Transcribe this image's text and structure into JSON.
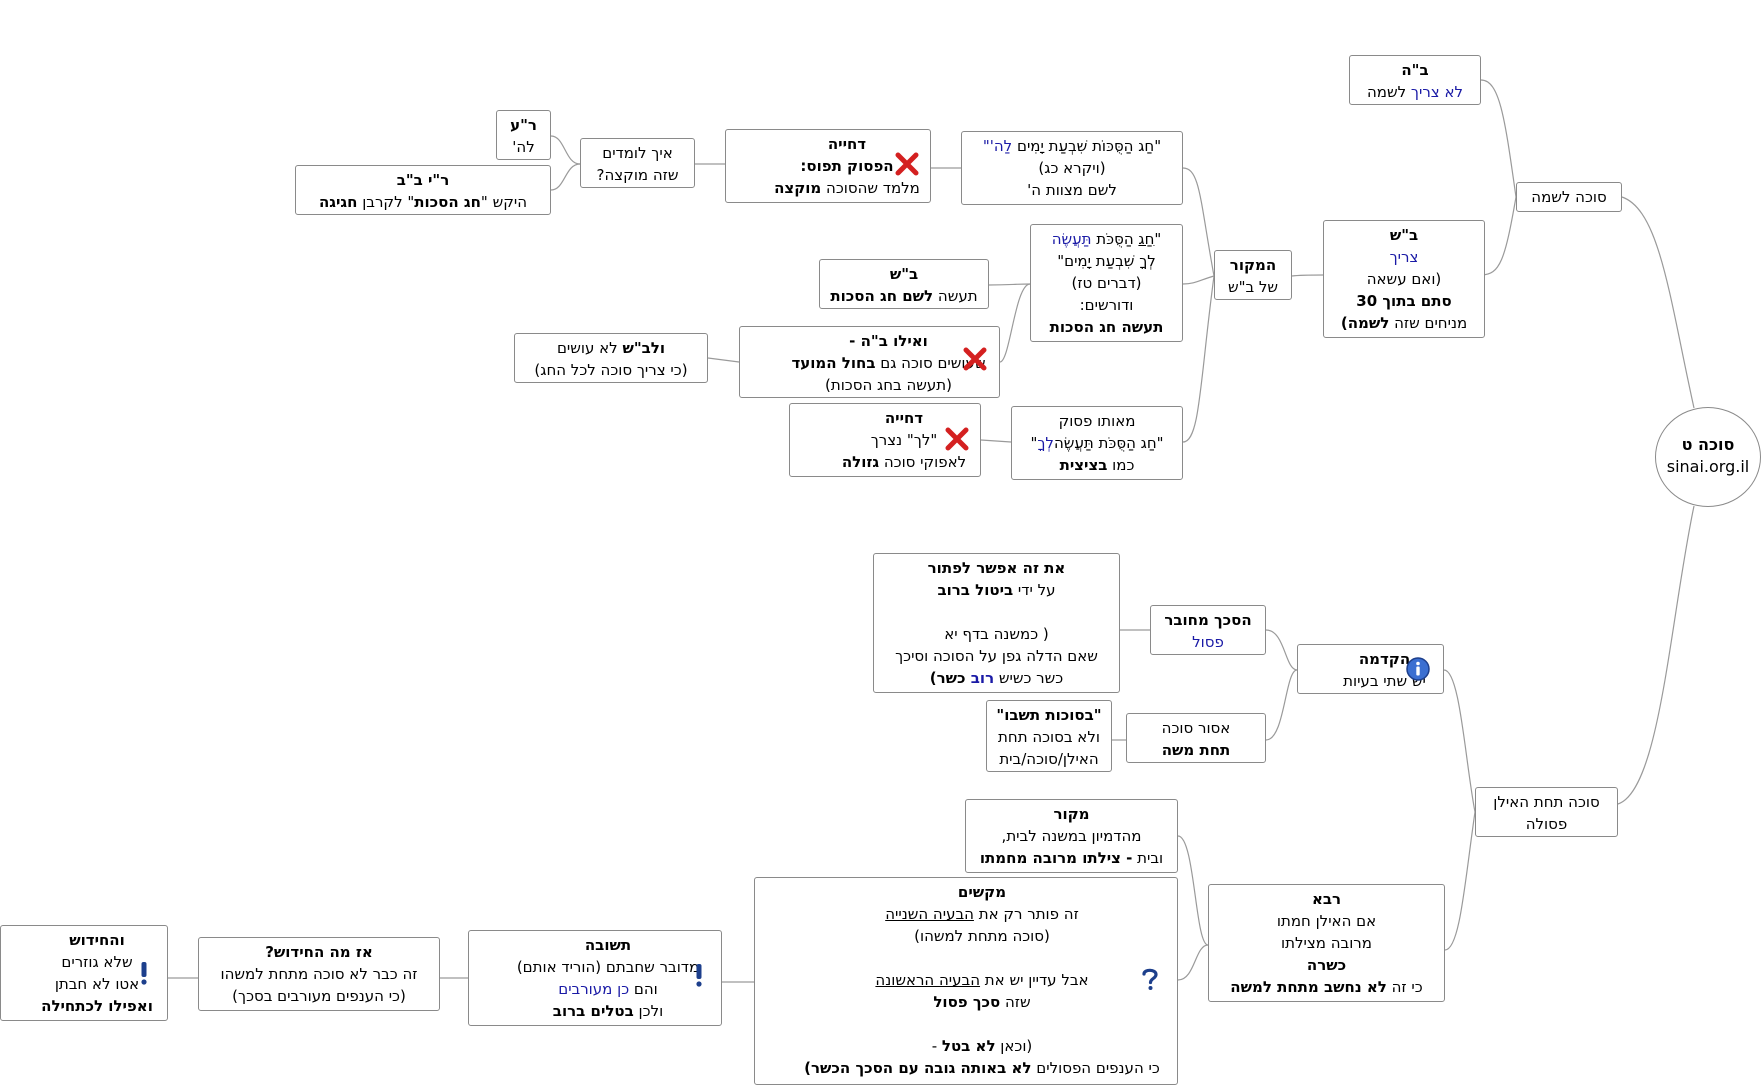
{
  "root": {
    "title": "סוכה ט",
    "site": "sinai.org.il"
  },
  "nodes": {
    "lishma": "סוכה לשמה",
    "beit_hillel": {
      "title": "ב\"ה",
      "w1": "לא צריך",
      "w2": " לשמה"
    },
    "beit_shammai": {
      "title": "ב\"ש",
      "l2": "צריך",
      "l3": "(ואם עשאה",
      "l4": "סתם בתוך 30",
      "l5a": "מניחים שזה ",
      "l5b": "לשמה)"
    },
    "hamakor": {
      "l1": "המקור",
      "l2": "של ב\"ש"
    },
    "pasuk1": {
      "l1a": "\"חַג הַסֻּכּוֹת שִׁבְעַת יָמִים  ",
      "l1b": "לַה'\"",
      "l2": "(ויקרא כג)",
      "l3": "לשם מצוות ה'"
    },
    "dechiya1": {
      "l1": "דחייה",
      "l2": "הפסוק תפוס:",
      "l3a": "מלמד שהסוכה ",
      "l3b": "מוקצה"
    },
    "eich": {
      "l1": "איך לומדים",
      "l2": "שזה מוקצה?"
    },
    "rabbi_akiva": {
      "l1": "ר\"ע",
      "l2": "לה'"
    },
    "ryb": {
      "l1": "ר\"י ב\"ב",
      "l2a": "היקש \"",
      "l2b": "חג הסכות",
      "l2c": "\" לקרבן ",
      "l2d": "חגיגה"
    },
    "pasuk2": {
      "l1a": "\"",
      "l1b": "חַג",
      "l1c": " הַסֻּכֹּת ",
      "l1d": "תַּעֲשֶׂה",
      "l2": "לְךָ שִׁבְעַת יָמִים\"",
      "l3": "(דברים טז)",
      "l4": "ודורשים:",
      "l5": "תעשה חג הסכות"
    },
    "bs2": {
      "l1": "ב\"ש",
      "l2a": "תעשה ",
      "l2b": "לשם חג הסכות"
    },
    "vailu": {
      "l1": "ואילו ב\"ה -",
      "l2a": "שעושים סוכה גם ",
      "l2b": "בחול המועד",
      "l3": "(תעשה בחג הסכות)"
    },
    "velabs": {
      "l1a": "ולב\"ש",
      "l1b": " לא עושים",
      "l2": "(כי צריך סוכה לכל החג)"
    },
    "meoto": {
      "l1": "מאותו פסוק",
      "l2a": "\"חַג הַסֻּכֹּת תַּעֲשֶׂה",
      "l2b": "לְךָ",
      "l2c": "\"",
      "l3a": "כמו ",
      "l3b": "בציצית"
    },
    "dechiya2": {
      "l1": "דחייה",
      "l2": "\"לך\" נצרך",
      "l3a": "לאפוקי סוכה ",
      "l3b": "גזולה"
    },
    "tachat_ilan": {
      "l1": "סוכה תחת האילן",
      "l2": "פסולה"
    },
    "hakdama": {
      "l1": "הקדמה",
      "l2": "יש שתי בעיות"
    },
    "hasechach": {
      "l1": "הסכך מחובר",
      "l2": "פסול"
    },
    "et_ze": {
      "l1": "את זה אפשר לפתור",
      "l2a": "על ידי ",
      "l2b": "ביטול ברוב",
      "l4": "( כמשנה בדף יא",
      "l5": "שאם הדלה גפן על הסוכה וסיכך",
      "l6a": "כשר כשיש ",
      "l6b": "רוב",
      "l6c": " כשר)"
    },
    "asur": {
      "l1": "אסור סוכה",
      "l2": "תחת משה"
    },
    "basukot": {
      "l1": "\"בסוכות תשבו\"",
      "l2": "ולא בסוכה תחת",
      "l3": "האילן/סוכה/בית"
    },
    "rava": {
      "l1": "רבא",
      "l2": "אם האילן חמתו",
      "l3": "מרובה מצילתו",
      "l4": "כשרה",
      "l5a": "כי זה ",
      "l5b": "לא נחשב מתחת למשה"
    },
    "makor2": {
      "l1": "מקור",
      "l2": "מהדמיון במשנה לבית,",
      "l3a": "ובית ",
      "l3b": "- צילתו מרובה מחמתו"
    },
    "makshim": {
      "l1": "מקשים",
      "l2a": "זה פותר רק את ",
      "l2b": "הבעיה השנייה",
      "l3": "(סוכה מתחת למשהו)",
      "l5a": "אבל עדיין יש את ",
      "l5b": "הבעיה הראשונה",
      "l6a": "שזה ",
      "l6b": "סכך פסול",
      "l8a": "(וכאן ",
      "l8b": "לא בטל",
      "l8c": " -",
      "l9a": "כי הענפים הפסולים ",
      "l9b": "לא באותה גובה עם הסכך הכשר)"
    },
    "teshuva": {
      "l1": "תשובה",
      "l2": "מדובר שחבתם (הוריד אותם)",
      "l3a": "והם ",
      "l3b": "כן מעורבים",
      "l4a": "ולכן  ",
      "l4b": "בטלים ברוב"
    },
    "az_ma": {
      "l1": "אז מה החידוש?",
      "l2": "זה כבר לא סוכה מתחת למשהו",
      "l3": "(כי הענפים מעורבים בסכך)"
    },
    "vehachidush": {
      "l1": "והחידוש",
      "l2": "שלא גוזרים",
      "l3": "אטו לא חבתן",
      "l4": "ואפילו לכתחילה"
    }
  },
  "icons": [
    "cross-icon",
    "cross-icon",
    "cross-icon",
    "info-icon",
    "question-icon",
    "exclamation-icon",
    "exclamation-icon"
  ],
  "colors": {
    "link_blue": "#1a1aa6",
    "border": "#8a8a8a",
    "cross_red": "#d42020"
  }
}
